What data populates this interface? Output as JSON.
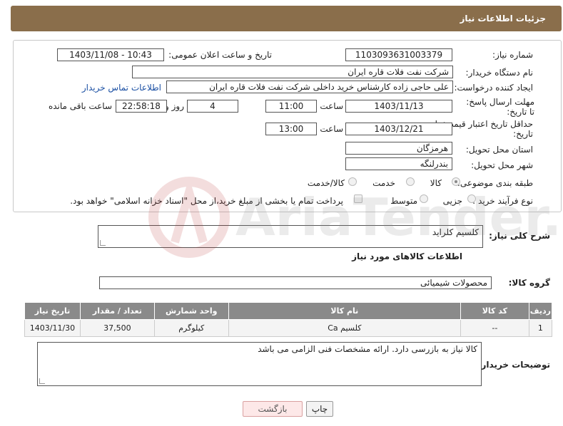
{
  "header": {
    "title": "جزئیات اطلاعات نیاز"
  },
  "form": {
    "need_number_label": "شماره نیاز:",
    "need_number": "1103093631003379",
    "announce_label": "تاریخ و ساعت اعلان عمومی:",
    "announce_value": "1403/11/08 - 10:43",
    "buyer_label": "نام دستگاه خریدار:",
    "buyer_value": "شرکت نفت فلات قاره ایران",
    "creator_label": "ایجاد کننده درخواست:",
    "creator_value": "علی حاجی زاده کارشناس خرید داخلی شرکت نفت فلات قاره ایران",
    "contact_link": "اطلاعات تماس خریدار",
    "deadline_label": "مهلت ارسال پاسخ: تا تاریخ:",
    "deadline_date": "1403/11/13",
    "hour_label": "ساعت",
    "deadline_time": "11:00",
    "days_value": "4",
    "days_label": "روز و",
    "remaining_time": "22:58:18",
    "remaining_label": "ساعت باقی مانده",
    "validity_label": "حداقل تاریخ اعتبار قیمت: تا تاریخ:",
    "validity_date": "1403/12/21",
    "validity_hour_label": "ساعت",
    "validity_time": "13:00",
    "province_label": "استان محل تحویل:",
    "province_value": "هرمزگان",
    "city_label": "شهر محل تحویل:",
    "city_value": "بندرلنگه",
    "category_label": "طبقه بندی موضوعی:",
    "category_options": [
      "کالا",
      "خدمت",
      "کالا/خدمت"
    ],
    "purchase_label": "نوع فرآیند خرید :",
    "purchase_options": [
      "جزیی",
      "متوسط"
    ],
    "payment_note": "پرداخت تمام یا بخشی از مبلغ خرید،از محل \"اسناد خزانه اسلامی\" خواهد بود."
  },
  "summary": {
    "label": "شرح کلی نیاز:",
    "value": "کلسیم کلراید"
  },
  "goods_info_title": "اطلاعات کالاهای مورد نیاز",
  "goods_group": {
    "label": "گروه کالا:",
    "value": "محصولات شیمیائی"
  },
  "table": {
    "headers": [
      "ردیف",
      "کد کالا",
      "نام کالا",
      "واحد شمارش",
      "تعداد / مقدار",
      "تاریخ نیاز"
    ],
    "rows": [
      [
        "1",
        "--",
        "کلسیم Ca",
        "کیلوگرم",
        "37,500",
        "1403/11/30"
      ]
    ]
  },
  "buyer_notes": {
    "label": "توضیحات خریدار:",
    "value": "کالا نیاز به بازرسی دارد. ارائه مشخصات فنی الزامی می باشد"
  },
  "buttons": {
    "print": "چاپ",
    "back": "بازگشت"
  },
  "watermark": {
    "text": "AriaTender.neT"
  }
}
